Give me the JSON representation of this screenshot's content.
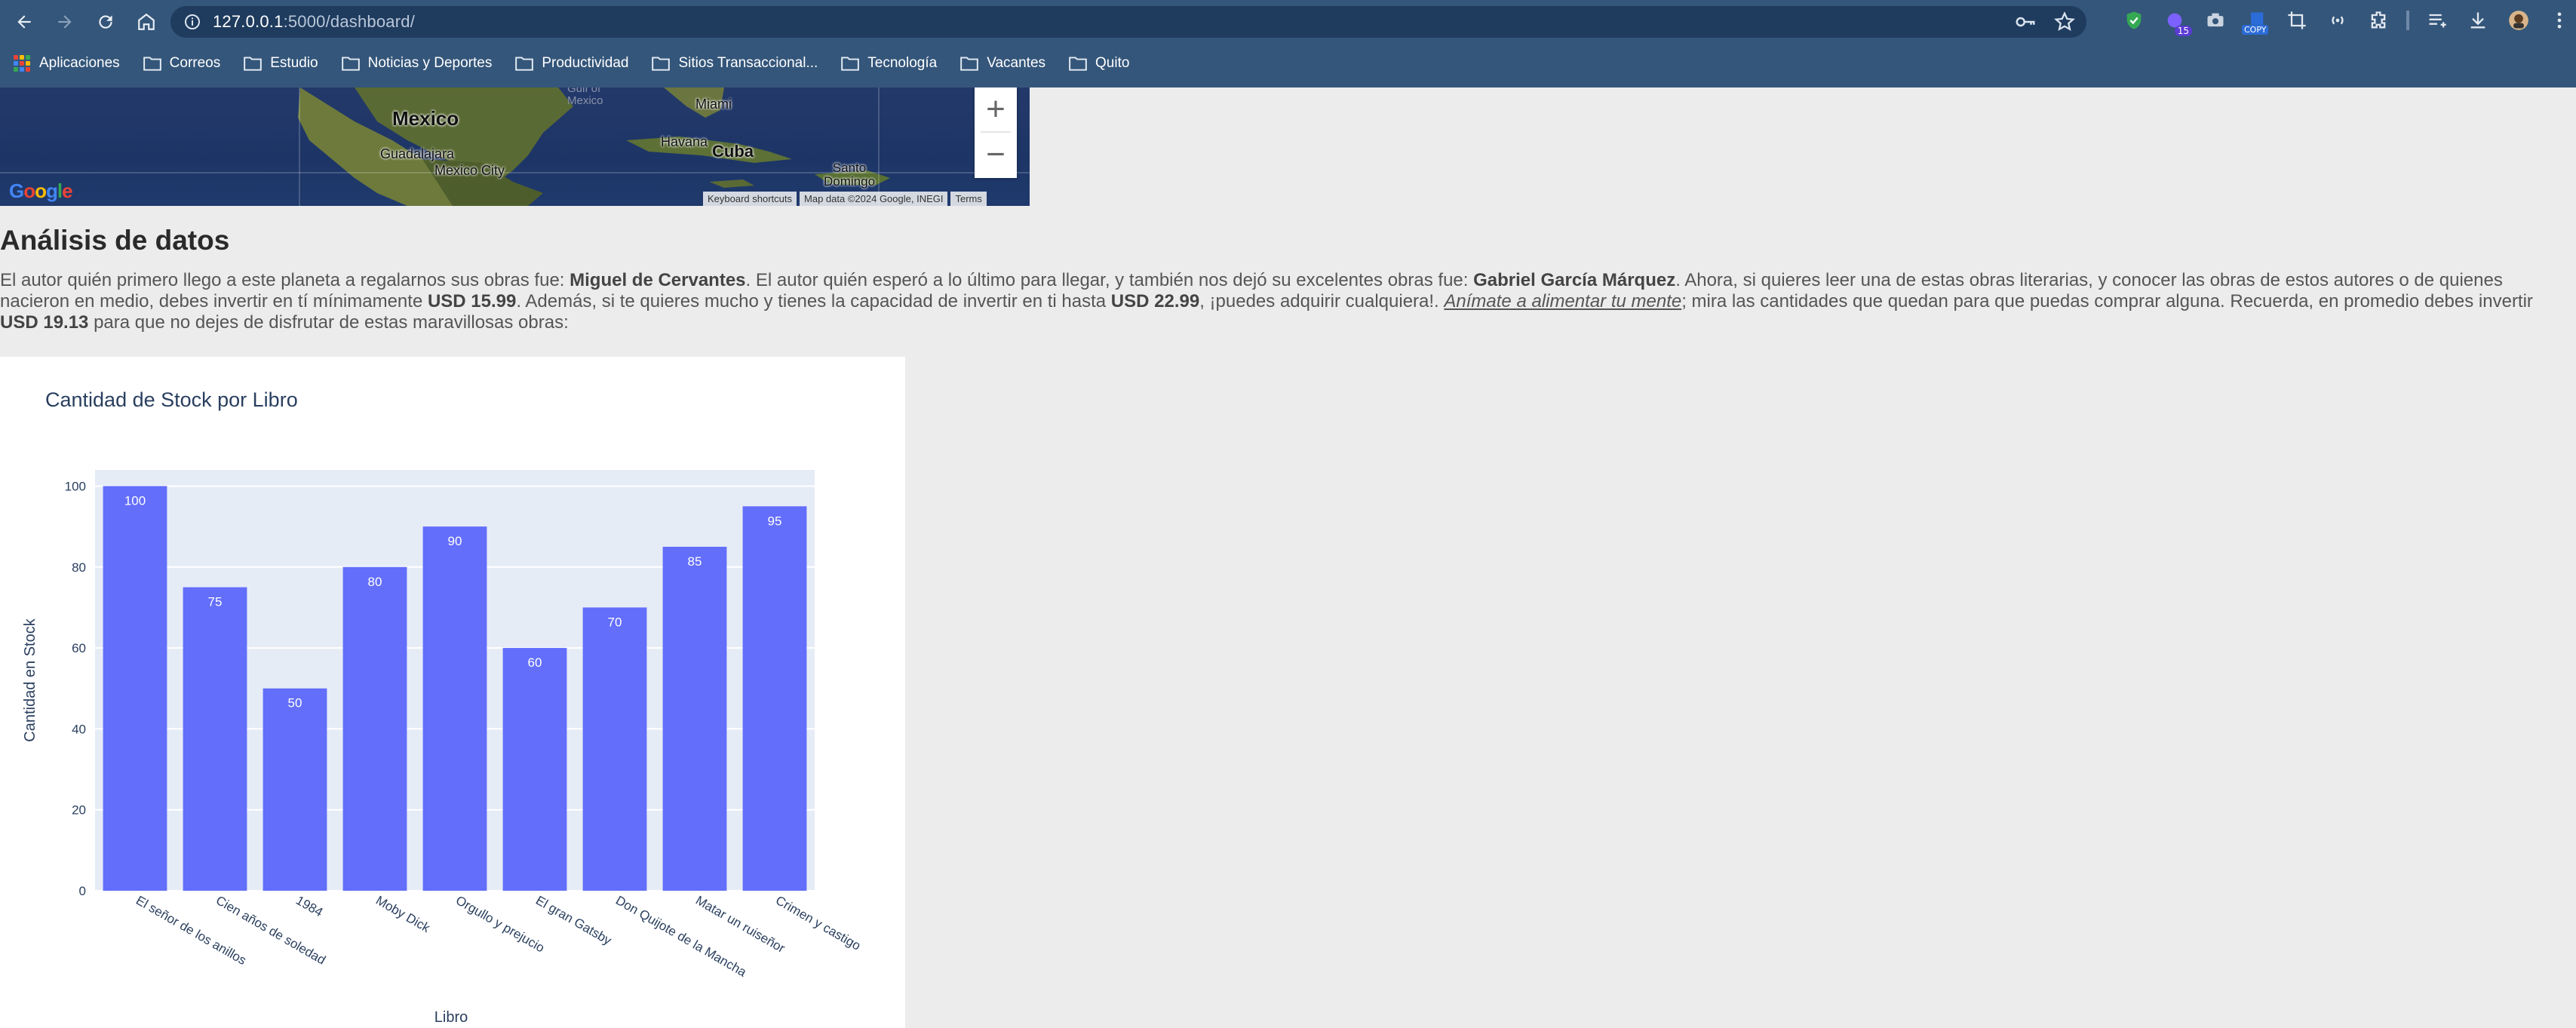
{
  "browser": {
    "url_host": "127.0.0.1",
    "url_rest": ":5000/dashboard/",
    "bookmarks": [
      {
        "label": "Aplicaciones",
        "icon": "apps-grid-icon"
      },
      {
        "label": "Correos",
        "icon": "folder-icon"
      },
      {
        "label": "Estudio",
        "icon": "folder-icon"
      },
      {
        "label": "Noticias y Deportes",
        "icon": "folder-icon"
      },
      {
        "label": "Productividad",
        "icon": "folder-icon"
      },
      {
        "label": "Sitios Transaccional...",
        "icon": "folder-icon"
      },
      {
        "label": "Tecnología",
        "icon": "folder-icon"
      },
      {
        "label": "Vacantes",
        "icon": "folder-icon"
      },
      {
        "label": "Quito",
        "icon": "folder-icon"
      }
    ],
    "extension_badges": {
      "count": "15",
      "copy": "COPY"
    }
  },
  "map": {
    "labels": {
      "mexico": "Mexico",
      "guadalajara": "Guadalajara",
      "mexico_city": "Mexico City",
      "havana": "Havana",
      "cuba": "Cuba",
      "miami": "Miami",
      "santo_domingo": "Santo\nDomingo",
      "gulf": "Gulf of\nMexico"
    },
    "zoom_in": "+",
    "zoom_out": "−",
    "footer": {
      "shortcuts": "Keyboard shortcuts",
      "data": "Map data ©2024 Google, INEGI",
      "terms": "Terms"
    },
    "logo": "Google"
  },
  "analysis": {
    "heading": "Análisis de datos",
    "p1": "El autor quién primero llego a este planeta a regalarnos sus obras fue: ",
    "first_author": "Miguel de Cervantes",
    "p2": ". El autor quién esperó a lo último para llegar, y también nos dejó su excelentes obras fue: ",
    "last_author": "Gabriel García Márquez",
    "p3": ". Ahora, si quieres leer una de estas obras literarias, y conocer las obras de estos autores o de quienes nacieron en medio, debes invertir en tí mínimamente ",
    "min_price": "USD 15.99",
    "p4": ". Además, si te quieres mucho y tienes la capacidad de invertir en ti hasta ",
    "max_price": "USD 22.99",
    "p5": ", ¡puedes adquirir cualquiera!. ",
    "link": "Anímate a alimentar tu mente",
    "p6": "; mira las cantidades que quedan para que puedas comprar alguna. Recuerda, en promedio debes invertir ",
    "avg_price": "USD 19.13",
    "p7": " para que no dejes de disfrutar de estas maravillosas obras:"
  },
  "chart_data": {
    "type": "bar",
    "title": "Cantidad de Stock por Libro",
    "xlabel": "Libro",
    "ylabel": "Cantidad en Stock",
    "categories": [
      "El señor de los anillos",
      "Cien años de soledad",
      "1984",
      "Moby Dick",
      "Orgullo y prejucio",
      "El gran Gatsby",
      "Don Quijote de la Mancha",
      "Matar un ruiseñor",
      "Crimen y castigo"
    ],
    "values": [
      100,
      75,
      50,
      80,
      90,
      60,
      70,
      85,
      95
    ],
    "ylim": [
      0,
      104
    ],
    "yticks": [
      0,
      20,
      40,
      60,
      80,
      100
    ],
    "bar_color": "#636efa",
    "plot_bg": "#e5ecf6",
    "grid": true
  }
}
